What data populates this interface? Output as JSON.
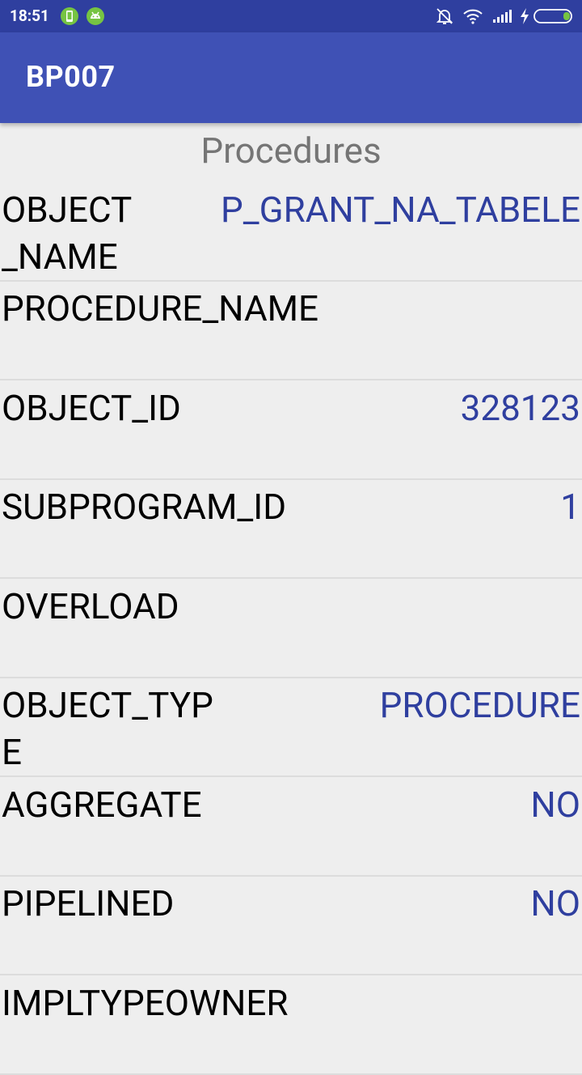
{
  "status_bar": {
    "time": "18:51",
    "icons": [
      "phone-notification-icon",
      "android-notification-icon",
      "mute-icon",
      "wifi-icon",
      "signal-icon",
      "charging-icon",
      "battery-icon"
    ]
  },
  "app_bar": {
    "title": "BP007"
  },
  "section": {
    "title": "Procedures"
  },
  "rows": [
    {
      "label": "OBJECT\n_NAME",
      "value": "P_GRANT_NA_TABELE"
    },
    {
      "label": "PROCEDURE_NAME",
      "value": ""
    },
    {
      "label": "OBJECT_ID",
      "value": "328123"
    },
    {
      "label": "SUBPROGRAM_ID",
      "value": "1"
    },
    {
      "label": "OVERLOAD",
      "value": ""
    },
    {
      "label": "OBJECT_TYP\nE",
      "value": "PROCEDURE"
    },
    {
      "label": "AGGREGATE",
      "value": "NO"
    },
    {
      "label": "PIPELINED",
      "value": "NO"
    },
    {
      "label": "IMPLTYPEOWNER",
      "value": ""
    }
  ]
}
